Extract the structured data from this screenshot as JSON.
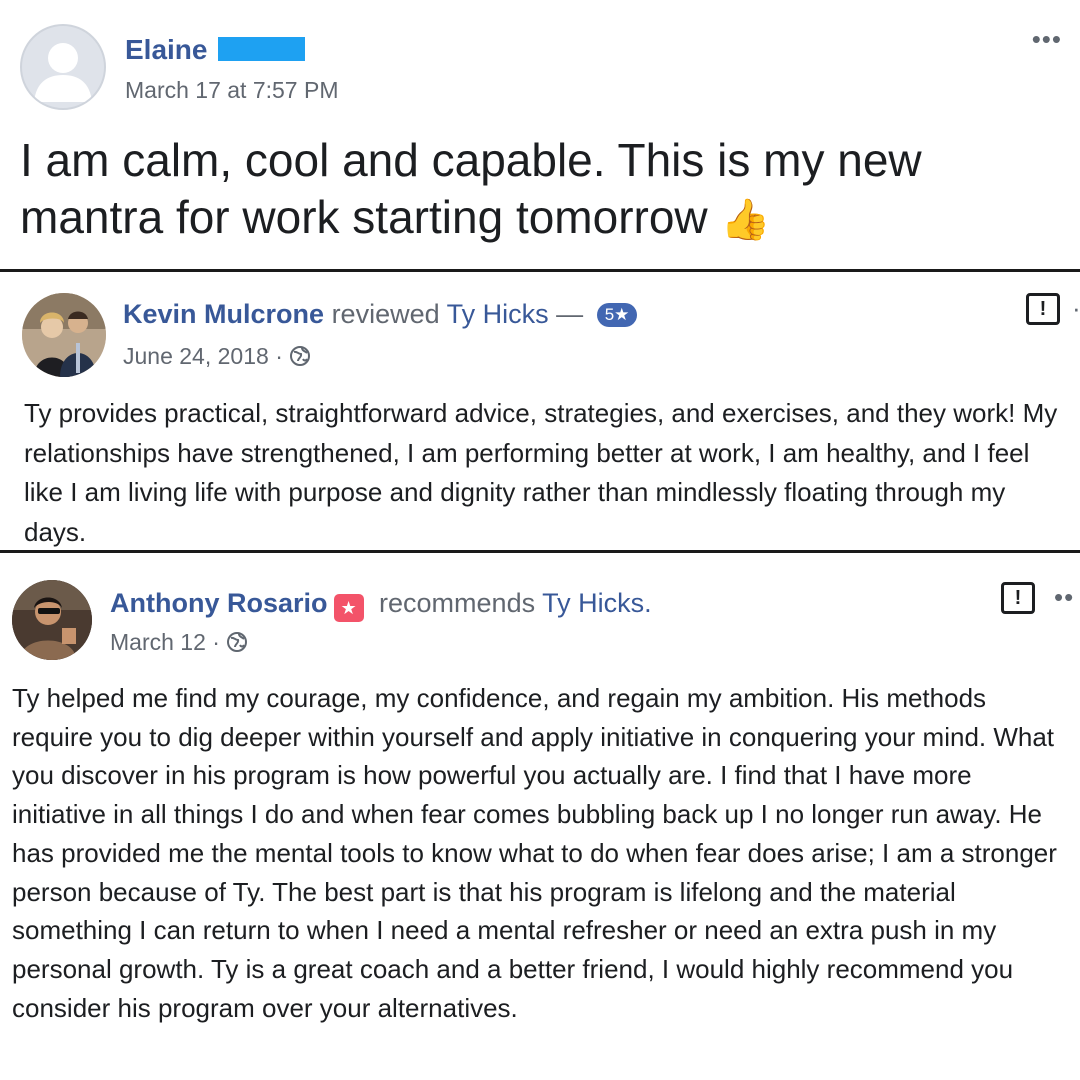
{
  "post": {
    "author": "Elaine",
    "timestamp": "March 17 at 7:57 PM",
    "text": "I am calm, cool and capable. This is my new mantra for work starting tomorrow",
    "emoji": "👍",
    "menu": "•••"
  },
  "review1": {
    "author": "Kevin Mulcrone",
    "action": "reviewed",
    "target": "Ty Hicks",
    "dash": "—",
    "rating": "5★",
    "date": "June 24, 2018",
    "sep": "·",
    "report": "!",
    "body": "Ty provides practical, straightforward advice, strategies, and exercises, and they work! My relationships have strengthened, I am performing better at work, I am healthy, and I feel like I am living life with purpose and dignity rather than mindlessly floating through my days."
  },
  "review2": {
    "author": "Anthony Rosario",
    "action": "recommends",
    "target": "Ty Hicks.",
    "date": "March 12",
    "sep": "·",
    "report": "!",
    "menu": "••",
    "body": "Ty helped me find my courage, my confidence, and regain my ambition. His methods require you to dig deeper within yourself and apply initiative in conquering your mind. What you discover in his program is how powerful you actually are. I find that I have more initiative in all things I do and when fear comes bubbling back up I no longer run away. He has provided me the mental tools to know what to do when fear does arise; I am a stronger person because of Ty. The best part is that his program is lifelong and the material something I can return to when I need a mental refresher or need an extra push in my personal growth. Ty is a great coach and a better friend, I would highly recommend you consider his program over your alternatives."
  },
  "colors": {
    "link": "#385898",
    "badge": "#4267b2",
    "recommend": "#f35369",
    "redaction": "#1ea1f2"
  }
}
